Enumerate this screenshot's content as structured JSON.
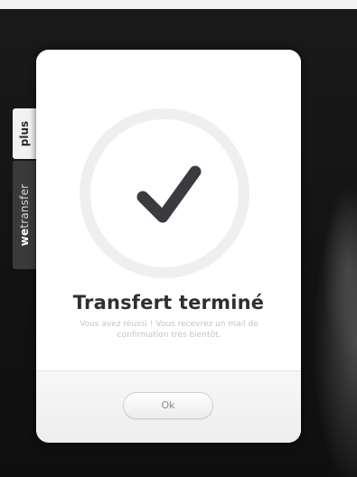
{
  "side_tab": {
    "plus_label": "plus",
    "brand_prefix": "we",
    "brand_suffix": "transfer"
  },
  "dialog": {
    "icon": "checkmark-icon",
    "title": "Transfert terminé",
    "subtitle": "Vous avez réussi ! Vous recevrez un mail de confirmation très bientôt.",
    "ok_label": "Ok"
  },
  "colors": {
    "background": "#141414",
    "dialog_bg": "#ffffff",
    "checkmark": "#3a3a40",
    "ring": "#efefef",
    "title_text": "#2f2f2f"
  }
}
